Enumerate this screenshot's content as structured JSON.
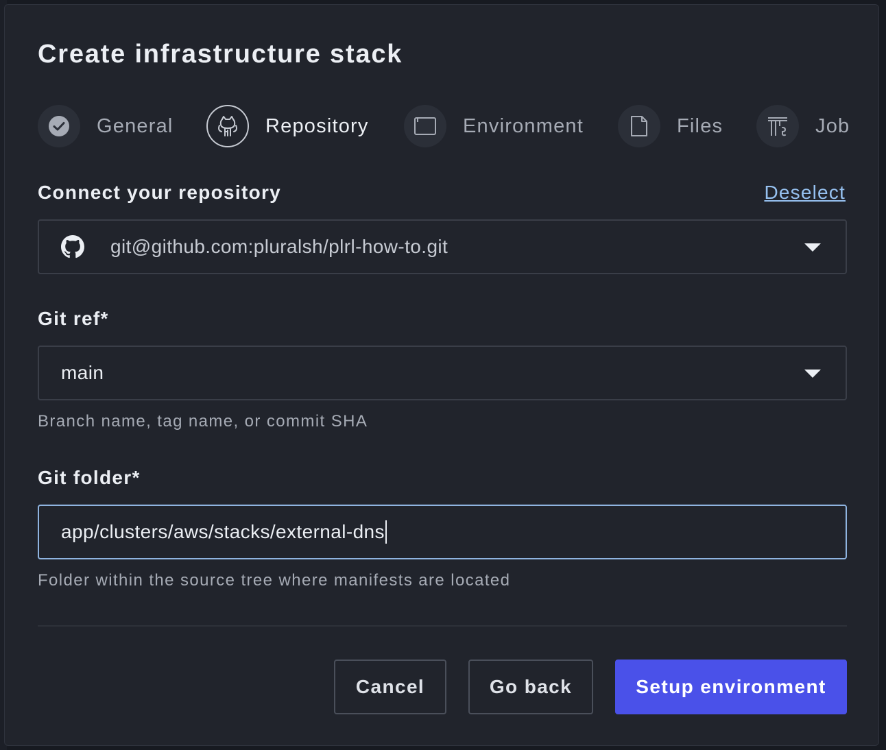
{
  "modal": {
    "title": "Create infrastructure stack"
  },
  "stepper": {
    "steps": [
      {
        "label": "General",
        "icon": "checkmark-icon",
        "state": "completed"
      },
      {
        "label": "Repository",
        "icon": "git-cat-icon",
        "state": "active"
      },
      {
        "label": "Environment",
        "icon": "terminal-window-icon",
        "state": "pending"
      },
      {
        "label": "Files",
        "icon": "file-icon",
        "state": "pending"
      },
      {
        "label": "Job",
        "icon": "job-icon",
        "state": "pending"
      }
    ]
  },
  "repository": {
    "label": "Connect your repository",
    "deselect_label": "Deselect",
    "selected_repo": "git@github.com:pluralsh/plrl-how-to.git",
    "icon": "github-icon"
  },
  "git_ref": {
    "label": "Git ref*",
    "value": "main",
    "hint": "Branch name, tag name, or commit SHA"
  },
  "git_folder": {
    "label": "Git folder*",
    "value": "app/clusters/aws/stacks/external-dns",
    "hint": "Folder within the source tree where manifests are located"
  },
  "actions": {
    "cancel_label": "Cancel",
    "back_label": "Go back",
    "next_label": "Setup environment"
  },
  "colors": {
    "background": "#21242c",
    "primary": "#4a51e9",
    "link": "#96c1f0",
    "focus_border": "#8fb4e0"
  }
}
